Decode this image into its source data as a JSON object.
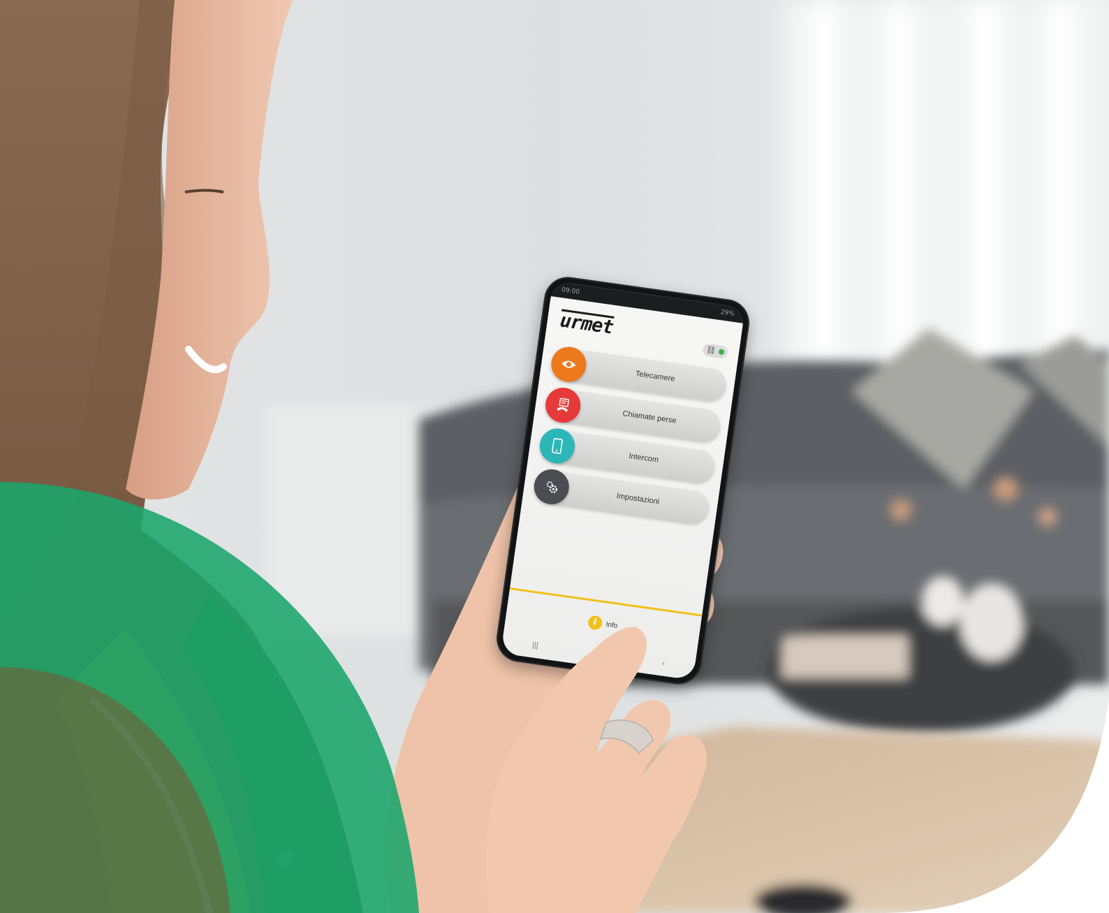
{
  "app": {
    "brand": "urmet",
    "status_bar": {
      "time": "09:00",
      "right": "29%"
    },
    "menu": [
      {
        "label": "Telecamere",
        "icon": "eye-icon",
        "color": "#ec7a1c"
      },
      {
        "label": "Chiamate perse",
        "icon": "missed-call-icon",
        "color": "#e63a3a"
      },
      {
        "label": "Intercom",
        "icon": "smartphone-icon",
        "color": "#2db6b8"
      },
      {
        "label": "Impostazioni",
        "icon": "gears-icon",
        "color": "#4a4d52"
      }
    ],
    "info_label": "Info",
    "connection_status_color": "#39b54a",
    "accent_line_color": "#f2c01b"
  },
  "decor": {
    "green_arc_color": "#1aa56b"
  }
}
